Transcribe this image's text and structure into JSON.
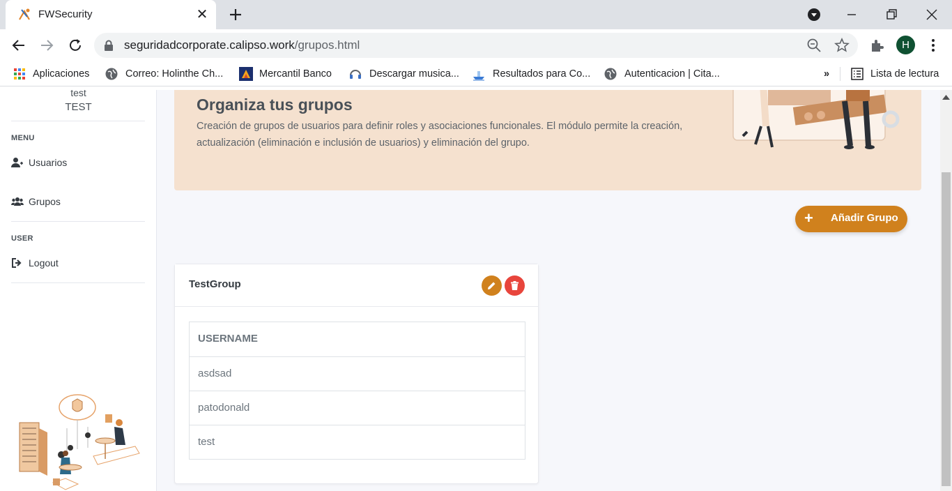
{
  "browser": {
    "tab_title": "FWSecurity",
    "url_domain": "seguridadcorporate.calipso.work",
    "url_path": "/grupos.html",
    "profile_initial": "H",
    "bookmarks": [
      {
        "label": "Aplicaciones",
        "icon": "apps-grid-icon"
      },
      {
        "label": "Correo: Holinthe Ch...",
        "icon": "globe-icon"
      },
      {
        "label": "Mercantil Banco",
        "icon": "bank-icon"
      },
      {
        "label": "Descargar musica...",
        "icon": "music-icon"
      },
      {
        "label": "Resultados para Co...",
        "icon": "ship-icon"
      },
      {
        "label": "Autenticacion | Cita...",
        "icon": "globe-icon"
      }
    ],
    "overflow_label": "»",
    "reading_list": "Lista de lectura"
  },
  "sidebar": {
    "user_lower": "test",
    "user_upper": "TEST",
    "menu_heading": "MENU",
    "user_heading": "USER",
    "items": [
      {
        "label": "Usuarios"
      },
      {
        "label": "Grupos"
      },
      {
        "label": "Logout"
      }
    ]
  },
  "banner": {
    "title": "Organiza tus grupos",
    "text": "Creación de grupos de usuarios para definir roles y asociaciones funcionales. El módulo permite la creación, actualización (eliminación e inclusión de usuarios) y eliminación del grupo."
  },
  "add_button": {
    "plus": "+",
    "label": "Añadir Grupo"
  },
  "group_card": {
    "title": "TestGroup",
    "column_header": "USERNAME",
    "usernames": [
      "asdsad",
      "patodonald",
      "test"
    ]
  },
  "colors": {
    "accent": "#d0811d",
    "danger": "#e8453c",
    "banner_bg": "#f5e1cf"
  }
}
